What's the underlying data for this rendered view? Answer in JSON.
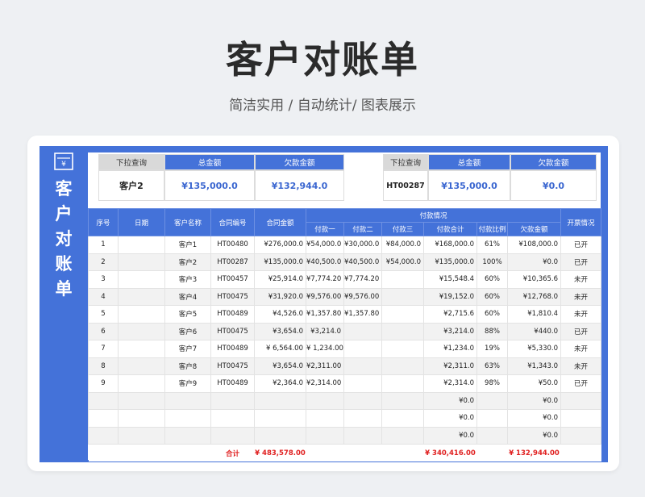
{
  "hero": {
    "title": "客户对账单",
    "subtitle": "简洁实用 / 自动统计/ 图表展示"
  },
  "side": {
    "title_chars": [
      "客",
      "户",
      "对",
      "账",
      "单"
    ],
    "icon": "invoice-icon"
  },
  "summary_left": {
    "dropdown_label": "下拉查询",
    "total_label": "总金额",
    "owed_label": "欠款金额",
    "selected": "客户2",
    "total": "¥135,000.0",
    "owed": "¥132,944.0"
  },
  "summary_right": {
    "dropdown_label": "下拉查询",
    "total_label": "总金额",
    "owed_label": "欠款金额",
    "selected": "HT00287",
    "total": "¥135,000.0",
    "owed": "¥0.0"
  },
  "table": {
    "headers": {
      "seq": "序号",
      "date": "日期",
      "customer": "客户名称",
      "contract_no": "合同编号",
      "contract_amount": "合同金额",
      "payment_group": "付款情况",
      "pay1": "付款一",
      "pay2": "付款二",
      "pay3": "付款三",
      "pay_total": "付款合计",
      "pay_ratio": "付款比例",
      "owed": "欠款金额",
      "invoice": "开票情况"
    },
    "rows": [
      [
        "1",
        "",
        "客户1",
        "HT00480",
        "¥276,000.0",
        "¥54,000.0",
        "¥30,000.0",
        "¥84,000.0",
        "¥168,000.0",
        "61%",
        "¥108,000.0",
        "已开"
      ],
      [
        "2",
        "",
        "客户2",
        "HT00287",
        "¥135,000.0",
        "¥40,500.0",
        "¥40,500.0",
        "¥54,000.0",
        "¥135,000.0",
        "100%",
        "¥0.0",
        "已开"
      ],
      [
        "3",
        "",
        "客户3",
        "HT00457",
        "¥25,914.0",
        "¥7,774.20",
        "¥7,774.20",
        "",
        "¥15,548.4",
        "60%",
        "¥10,365.6",
        "未开"
      ],
      [
        "4",
        "",
        "客户4",
        "HT00475",
        "¥31,920.0",
        "¥9,576.00",
        "¥9,576.00",
        "",
        "¥19,152.0",
        "60%",
        "¥12,768.0",
        "未开"
      ],
      [
        "5",
        "",
        "客户5",
        "HT00489",
        "¥4,526.0",
        "¥1,357.80",
        "¥1,357.80",
        "",
        "¥2,715.6",
        "60%",
        "¥1,810.4",
        "未开"
      ],
      [
        "6",
        "",
        "客户6",
        "HT00475",
        "¥3,654.0",
        "¥3,214.0",
        "",
        "",
        "¥3,214.0",
        "88%",
        "¥440.0",
        "已开"
      ],
      [
        "7",
        "",
        "客户7",
        "HT00489",
        "¥ 6,564.00",
        "¥ 1,234.00",
        "",
        "",
        "¥1,234.0",
        "19%",
        "¥5,330.0",
        "未开"
      ],
      [
        "8",
        "",
        "客户8",
        "HT00475",
        "¥3,654.0",
        "¥2,311.00",
        "",
        "",
        "¥2,311.0",
        "63%",
        "¥1,343.0",
        "未开"
      ],
      [
        "9",
        "",
        "客户9",
        "HT00489",
        "¥2,364.0",
        "¥2,314.00",
        "",
        "",
        "¥2,314.0",
        "98%",
        "¥50.0",
        "已开"
      ],
      [
        "",
        "",
        "",
        "",
        "",
        "",
        "",
        "",
        "¥0.0",
        "",
        "¥0.0",
        ""
      ],
      [
        "",
        "",
        "",
        "",
        "",
        "",
        "",
        "",
        "¥0.0",
        "",
        "¥0.0",
        ""
      ],
      [
        "",
        "",
        "",
        "",
        "",
        "",
        "",
        "",
        "¥0.0",
        "",
        "¥0.0",
        ""
      ]
    ],
    "totals": {
      "label": "合计",
      "contract_amount": "¥ 483,578.00",
      "pay_total": "¥ 340,416.00",
      "owed": "¥ 132,944.00"
    }
  },
  "colors": {
    "accent": "#4472d9",
    "total_red": "#e02020"
  }
}
